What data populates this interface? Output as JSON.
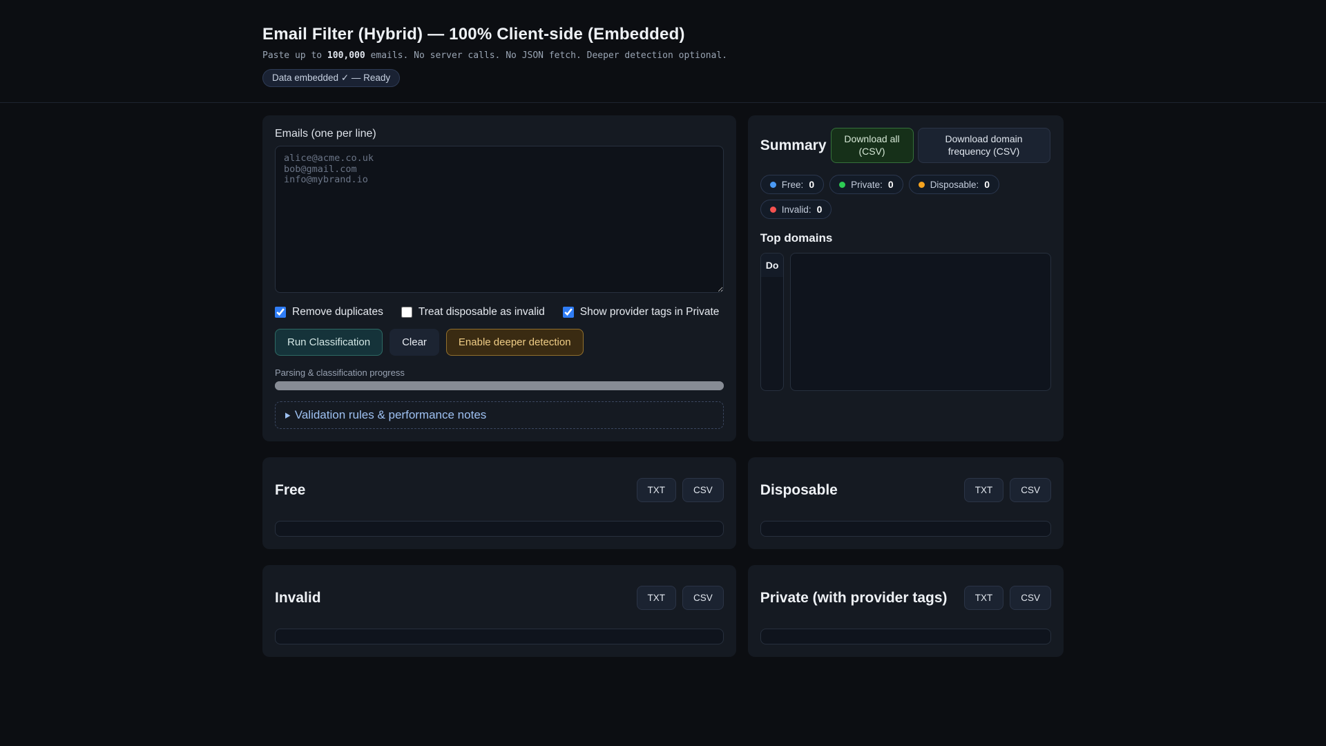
{
  "header": {
    "title": "Email Filter (Hybrid) — 100% Client-side (Embedded)",
    "subtitle_prefix": "Paste up to ",
    "subtitle_bold": "100,000",
    "subtitle_suffix": " emails. No server calls. No JSON fetch. Deeper detection optional.",
    "status_badge": "Data embedded ✓ — Ready"
  },
  "input_card": {
    "label": "Emails (one per line)",
    "textarea_placeholder": "alice@acme.co.uk\nbob@gmail.com\ninfo@mybrand.io",
    "checkboxes": [
      {
        "label": "Remove duplicates",
        "checked": true
      },
      {
        "label": "Treat disposable as invalid",
        "checked": false
      },
      {
        "label": "Show provider tags in Private",
        "checked": true
      }
    ],
    "run_button": "Run Classification",
    "clear_button": "Clear",
    "deeper_button": "Enable deeper detection",
    "progress_label": "Parsing & classification progress",
    "progress_percent": 100,
    "details_summary": "Validation rules & performance notes"
  },
  "summary_card": {
    "title": "Summary",
    "download_all_button": "Download all (CSV)",
    "download_freq_button": "Download domain frequency (CSV)",
    "counters": [
      {
        "label": "Free:",
        "value": "0",
        "color": "#4a9af5"
      },
      {
        "label": "Private:",
        "value": "0",
        "color": "#2dcc54"
      },
      {
        "label": "Disposable:",
        "value": "0",
        "color": "#f6a41f"
      },
      {
        "label": "Invalid:",
        "value": "0",
        "color": "#f4514f"
      }
    ],
    "top_domains_title": "Top domains",
    "table_header_clipped": "Do"
  },
  "result_cards": [
    {
      "title": "Free"
    },
    {
      "title": "Disposable"
    },
    {
      "title": "Invalid"
    },
    {
      "title": "Private (with provider tags)"
    }
  ],
  "export_buttons": {
    "txt": "TXT",
    "csv": "CSV"
  },
  "colors": {
    "accent_checkbox": "#2f7df6",
    "run_button_bg": "#15333a",
    "deeper_button_bg": "#3a2b12",
    "download_all_bg": "#163019",
    "link_blue": "#9ec1f2",
    "progress_gray": "#878c95"
  }
}
